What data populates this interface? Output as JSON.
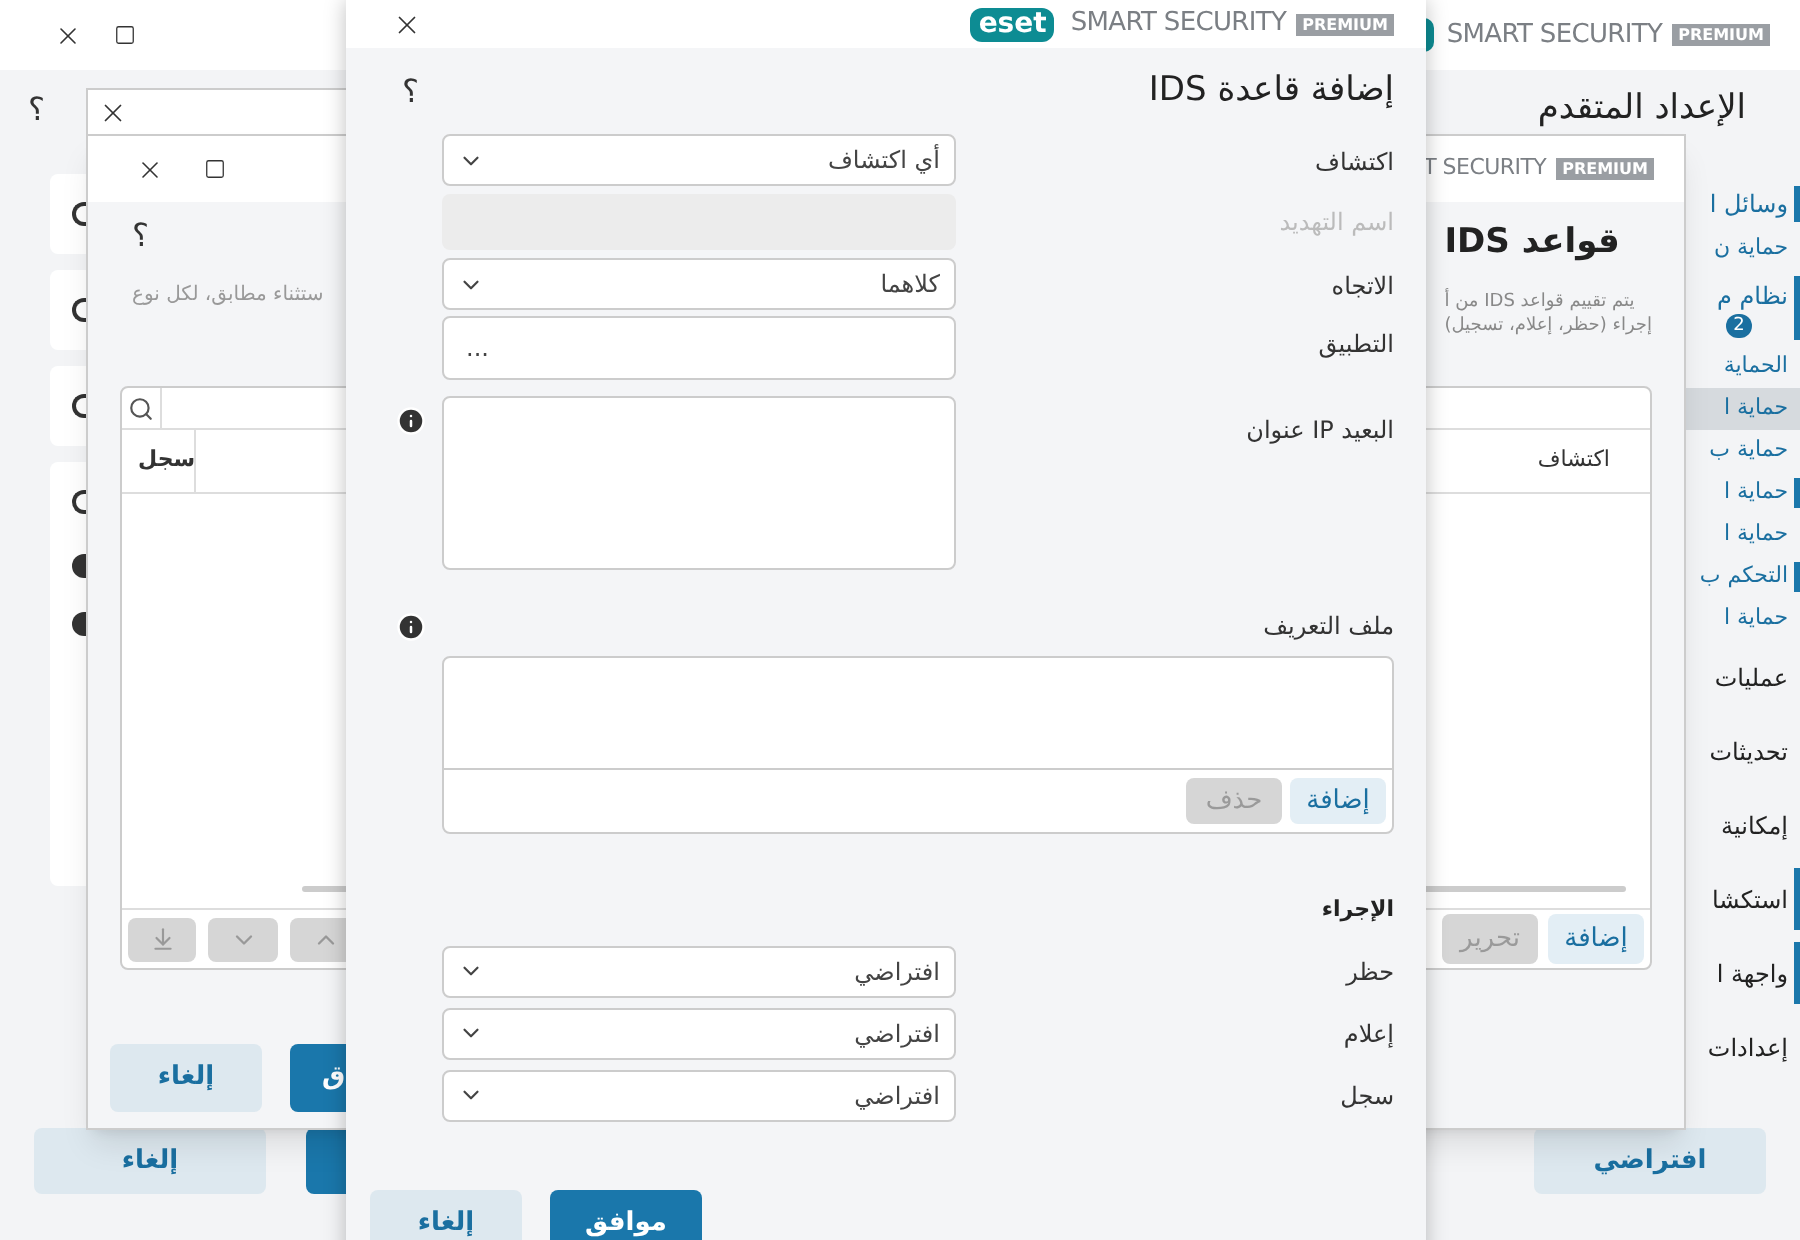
{
  "main_window": {
    "brand": {
      "product": "SMART SECURITY",
      "edition": "PREMIUM"
    },
    "title": "الإعداد المتقدم",
    "help": "؟",
    "sidebar": {
      "items": [
        {
          "label": "وسائل ا",
          "kind": "header",
          "marker": true,
          "selected": false
        },
        {
          "label": "حماية ن",
          "kind": "link",
          "marker": false,
          "selected": false
        },
        {
          "label": "نظام م",
          "kind": "header",
          "marker": true,
          "selected": false,
          "badge": "2"
        },
        {
          "label": "الحماية",
          "kind": "link",
          "marker": false,
          "selected": false
        },
        {
          "label": "حماية ا",
          "kind": "link",
          "marker": false,
          "selected": true
        },
        {
          "label": "حماية ب",
          "kind": "link",
          "marker": false,
          "selected": false
        },
        {
          "label": "حماية ا",
          "kind": "link",
          "marker": true,
          "selected": false
        },
        {
          "label": "حماية ا",
          "kind": "link",
          "marker": false,
          "selected": false
        },
        {
          "label": "التحكم ب",
          "kind": "link",
          "marker": true,
          "selected": false
        },
        {
          "label": "حماية ا",
          "kind": "link",
          "marker": false,
          "selected": false
        },
        {
          "label": "عمليات",
          "kind": "group",
          "marker": false,
          "selected": false
        },
        {
          "label": "تحديثات",
          "kind": "group",
          "marker": false,
          "selected": false
        },
        {
          "label": "إمكانية",
          "kind": "group",
          "marker": false,
          "selected": false
        },
        {
          "label": "استكشا",
          "kind": "group",
          "marker": true,
          "selected": false
        },
        {
          "label": "واجهة ا",
          "kind": "group",
          "marker": true,
          "selected": false
        },
        {
          "label": "إعدادات",
          "kind": "group",
          "marker": false,
          "selected": false
        }
      ]
    },
    "buttons": [
      {
        "kind": "secondary",
        "label": "افتراضي"
      },
      {
        "kind": "primary"
      },
      {
        "kind": "secondary",
        "label": "إلغاء"
      }
    ]
  },
  "rules_window": {
    "brand": {
      "product": "T SECURITY",
      "edition": "PREMIUM"
    },
    "title": "قواعد IDS",
    "help": "؟",
    "note": "ستثناء مطابق، لكل نوع",
    "description_lines": [
      "يتم تقييم قواعد IDS من أ",
      "إجراء (حظر، إعلام، تسجيل)"
    ],
    "table": {
      "columns": [
        "اكتشاف",
        "سجل"
      ]
    },
    "toolbar": [
      {
        "label": "إضافة",
        "disabled": false
      },
      {
        "label": "تحرير",
        "disabled": true
      }
    ],
    "buttons": [
      {
        "kind": "primary",
        "label": "ق"
      },
      {
        "kind": "secondary",
        "label": "إلغاء"
      }
    ]
  },
  "dialog": {
    "logo": "eset",
    "brand": {
      "product": "SMART SECURITY",
      "edition": "PREMIUM"
    },
    "title": "إضافة قاعدة IDS",
    "help": "؟",
    "fields": [
      {
        "label": "اكتشاف",
        "kind": "select",
        "value": "أي اكتشاف",
        "info": false
      },
      {
        "label": "اسم التهديد",
        "kind": "disabled",
        "info": false
      },
      {
        "label": "الاتجاه",
        "kind": "select",
        "value": "كلاهما",
        "info": false
      },
      {
        "label": "التطبيق",
        "kind": "browse",
        "value": "...",
        "info": false
      },
      {
        "label": "عنوان IP البعيد",
        "kind": "textarea",
        "info": true
      }
    ],
    "profile": {
      "label": "ملف التعريف",
      "info": true,
      "buttons": [
        {
          "label": "إضافة",
          "disabled": false
        },
        {
          "label": "حذف",
          "disabled": true
        }
      ]
    },
    "action": {
      "heading": "الإجراء",
      "fields": [
        {
          "label": "حظر",
          "value": "افتراضي"
        },
        {
          "label": "إعلام",
          "value": "افتراضي"
        },
        {
          "label": "سجل",
          "value": "افتراضي"
        }
      ]
    },
    "buttons": [
      {
        "kind": "primary",
        "label": "موافق"
      },
      {
        "kind": "secondary",
        "label": "إلغاء"
      }
    ]
  }
}
